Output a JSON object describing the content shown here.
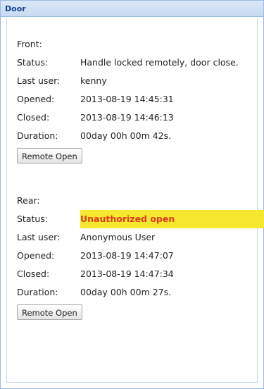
{
  "panel": {
    "title": "Door"
  },
  "front": {
    "title": "Front:",
    "rows": [
      {
        "label": "Status:",
        "value": "Handle locked remotely, door close."
      },
      {
        "label": "Last user:",
        "value": "kenny"
      },
      {
        "label": "Opened:",
        "value": "2013-08-19 14:45:31"
      },
      {
        "label": "Closed:",
        "value": "2013-08-19 14:46:13"
      },
      {
        "label": "Duration:",
        "value": "00day 00h 00m 42s."
      }
    ],
    "button": "Remote Open"
  },
  "rear": {
    "title": "Rear:",
    "rows": [
      {
        "label": "Status:",
        "value": "Unauthorized open"
      },
      {
        "label": "Last user:",
        "value": "Anonymous User"
      },
      {
        "label": "Opened:",
        "value": "2013-08-19 14:47:07"
      },
      {
        "label": "Closed:",
        "value": "2013-08-19 14:47:34"
      },
      {
        "label": "Duration:",
        "value": "00day 00h 00m 27s."
      }
    ],
    "button": "Remote Open"
  },
  "colors": {
    "alert_background": "#f5e82f",
    "alert_text": "#e03a1c",
    "header_text": "#15428b"
  }
}
